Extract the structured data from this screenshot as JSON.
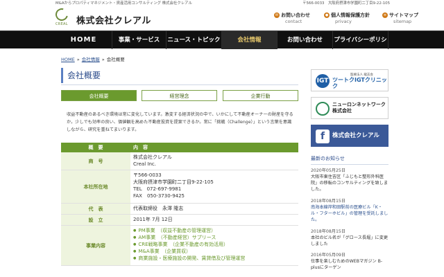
{
  "topbar": {
    "left": "M&Aからプロパティマネジメント・資産活用コンサルティング 株式会社クレアル",
    "right": "〒566-0033　大阪府摂津市学園町二丁目9-22-105"
  },
  "logo": {
    "sub": "CREAL"
  },
  "company_name": "株式会社クレアル",
  "header_links": [
    {
      "label": "お問い合わせ",
      "sub": "contact",
      "icon": "mail-icon"
    },
    {
      "label": "個人情報保護方針",
      "sub": "privacy",
      "icon": "lock-icon"
    },
    {
      "label": "サイトマップ",
      "sub": "sitemap",
      "icon": "sitemap-icon"
    }
  ],
  "nav": [
    {
      "label": "HOME"
    },
    {
      "label": "事業・サービス"
    },
    {
      "label": "ニュース・トピックス"
    },
    {
      "label": "会社情報",
      "active": true
    },
    {
      "label": "お問い合わせ"
    },
    {
      "label": "プライバシーポリシー"
    }
  ],
  "breadcrumb": {
    "home": "HOME",
    "sep": "»",
    "section": "会社情報",
    "current": "会社概要"
  },
  "page_title": "会社概要",
  "tabs": [
    {
      "label": "会社概要",
      "active": true
    },
    {
      "label": "経営理念"
    },
    {
      "label": "企業行動"
    }
  ],
  "intro": "収益不動産のあるべき環境は常に変化しています。激変する経済状況の中で、いかにして不動産オーナーの財産を守るか。少しでも効率の良い、価値観を高めた不動産投資を提案できるか。常に「挑戦（Challenge）」という言葉を意識しながら、研究を重ねてまいります。",
  "table": {
    "head": {
      "k": "概　要",
      "v": "内　容"
    },
    "rows": [
      {
        "k": "商　号",
        "v": [
          "株式会社クレアル",
          "Creal Inc."
        ]
      },
      {
        "k": "本社所在地",
        "v": [
          "〒566-0033",
          "大阪府摂津市学園町二丁目9-22-105",
          "TEL　072-697-9981",
          "FAX　050-3730-9425"
        ]
      },
      {
        "k": "代　表",
        "v": [
          "代表取締役　永澤 隆志"
        ]
      },
      {
        "k": "設　立",
        "v": [
          "2011年 7月 12日"
        ]
      },
      {
        "k": "事業内容",
        "v": [
          "PM事業　（収益不動産の管理運営）",
          "AM事業　（不動産経営）サプリース",
          "CRE戦略事業　（企業不動産の有効活用）",
          "M&A事業　（企業買収）",
          "商業施設・医療施設の開発、賃貸借及び管理運営"
        ]
      }
    ]
  },
  "sidebar": {
    "banners": [
      {
        "label": "ツートクIGTクリニック",
        "icon_text": "IGT",
        "small": "医療法人 龍志会"
      },
      {
        "label": "ニューロンネットワーク\n株式会社",
        "icon": "neuron-icon"
      },
      {
        "label": "株式会社クレアル",
        "icon_text": "f"
      }
    ],
    "news_heading": "最新のお知らせ",
    "news": [
      {
        "date": "2020年05月25日",
        "text": "大阪市東住吉区「ふじもと整形外科医院」の移転のコンサルティングを致しました。"
      },
      {
        "date": "2018年08月15日",
        "text": "南海本線岸和田駅前の医療ビル「K・ル・フターホビル」の管理を受託しました。"
      },
      {
        "date": "2018年08月15日",
        "text": "本社のビル名が「グロース長堀」に変更しました"
      },
      {
        "date": "2016年05月09日",
        "text": "仕事を楽しむためのWEBマガジン B-plusにターゲン"
      }
    ]
  }
}
